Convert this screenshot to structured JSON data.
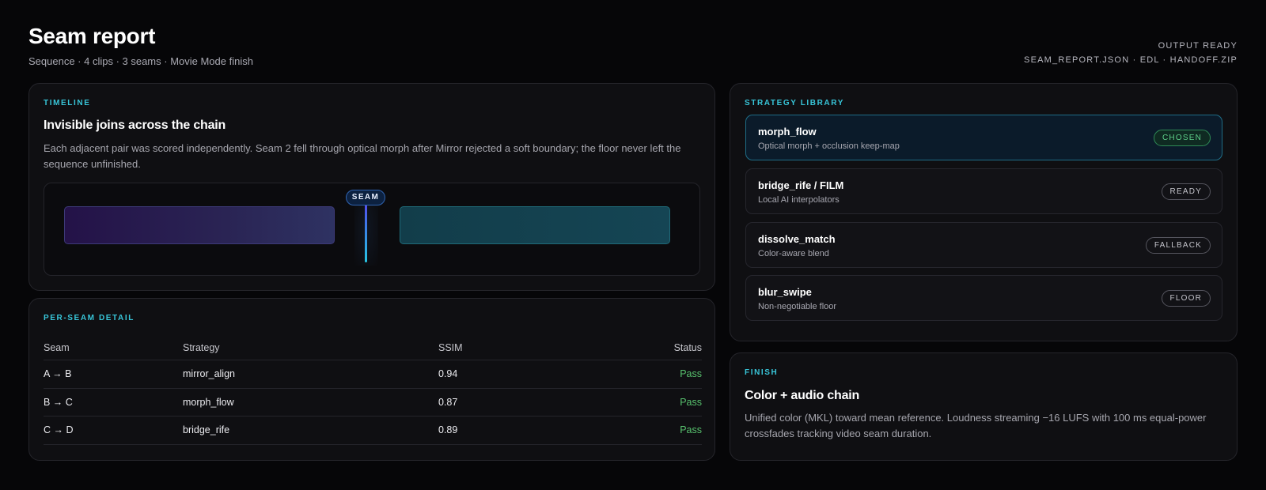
{
  "header": {
    "title": "Seam report",
    "subtitle": "Sequence · 4 clips · 3 seams · Movie Mode finish",
    "output_status": "OUTPUT READY",
    "output_files": "SEAM_REPORT.JSON · EDL · HANDOFF.ZIP"
  },
  "timeline": {
    "eyebrow": "TIMELINE",
    "title": "Invisible joins across the chain",
    "description": "Each adjacent pair was scored independently. Seam 2 fell through optical morph after Mirror rejected a soft boundary; the floor never left the sequence unfinished.",
    "seam_label": "SEAM"
  },
  "detail": {
    "eyebrow": "PER-SEAM DETAIL",
    "columns": [
      "Seam",
      "Strategy",
      "SSIM",
      "Status"
    ],
    "rows": [
      {
        "seam": "A → B",
        "strategy": "mirror_align",
        "ssim": "0.94",
        "status": "Pass"
      },
      {
        "seam": "B → C",
        "strategy": "morph_flow",
        "ssim": "0.87",
        "status": "Pass"
      },
      {
        "seam": "C → D",
        "strategy": "bridge_rife",
        "ssim": "0.89",
        "status": "Pass"
      }
    ]
  },
  "strategy": {
    "eyebrow": "STRATEGY LIBRARY",
    "items": [
      {
        "name": "morph_flow",
        "desc": "Optical morph + occlusion keep-map",
        "badge": "CHOSEN"
      },
      {
        "name": "bridge_rife / FILM",
        "desc": "Local AI interpolators",
        "badge": "READY"
      },
      {
        "name": "dissolve_match",
        "desc": "Color-aware blend",
        "badge": "FALLBACK"
      },
      {
        "name": "blur_swipe",
        "desc": "Non-negotiable floor",
        "badge": "FLOOR"
      }
    ]
  },
  "finish": {
    "eyebrow": "FINISH",
    "title": "Color + audio chain",
    "description": "Unified color (MKL) toward mean reference. Loudness streaming −16 LUFS with 100 ms equal-power crossfades tracking video seam duration."
  },
  "colors": {
    "accent": "#38c6d9",
    "pass": "#58c26e",
    "chosen_badge": "#5ed08a",
    "background": "#060608",
    "card": "#0f0f12"
  }
}
